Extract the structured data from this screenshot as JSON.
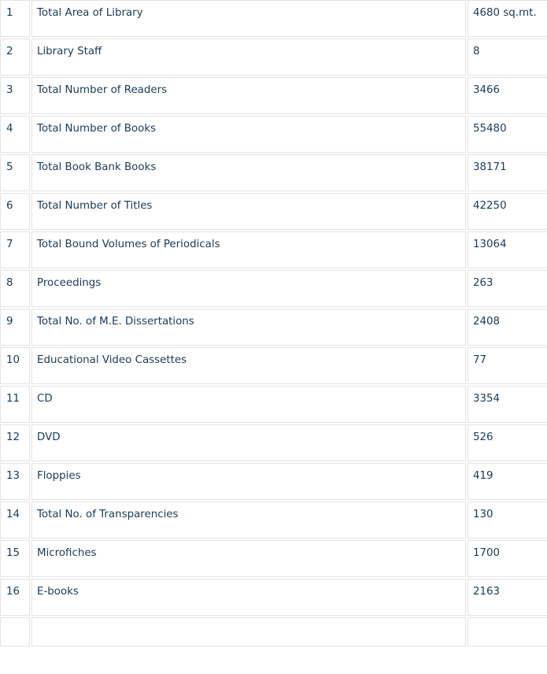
{
  "rows": [
    {
      "no": "1",
      "item": "Total Area of Library",
      "value": "4680 sq.mt."
    },
    {
      "no": "2",
      "item": "Library Staff",
      "value": "8"
    },
    {
      "no": "3",
      "item": "Total Number of Readers",
      "value": "3466"
    },
    {
      "no": "4",
      "item": "Total Number of Books",
      "value": "55480"
    },
    {
      "no": "5",
      "item": "Total Book Bank Books",
      "value": "38171"
    },
    {
      "no": "6",
      "item": "Total Number of Titles",
      "value": "42250"
    },
    {
      "no": "7",
      "item": "Total Bound Volumes of Periodicals",
      "value": "13064"
    },
    {
      "no": "8",
      "item": "Proceedings",
      "value": "263"
    },
    {
      "no": "9",
      "item": "Total No. of M.E. Dissertations",
      "value": "2408"
    },
    {
      "no": "10",
      "item": "Educational Video Cassettes",
      "value": "77"
    },
    {
      "no": "11",
      "item": "CD",
      "value": "3354"
    },
    {
      "no": "12",
      "item": "DVD",
      "value": "526"
    },
    {
      "no": "13",
      "item": "Floppies",
      "value": "419"
    },
    {
      "no": "14",
      "item": "Total No. of Transparencies",
      "value": "130"
    },
    {
      "no": "15",
      "item": "Microfiches",
      "value": "1700"
    },
    {
      "no": "16",
      "item": "E-books",
      "value": "2163"
    }
  ],
  "colors": {
    "text": "#1c3a55",
    "cell_border": "#e3e3e3",
    "background": "#ffffff"
  }
}
